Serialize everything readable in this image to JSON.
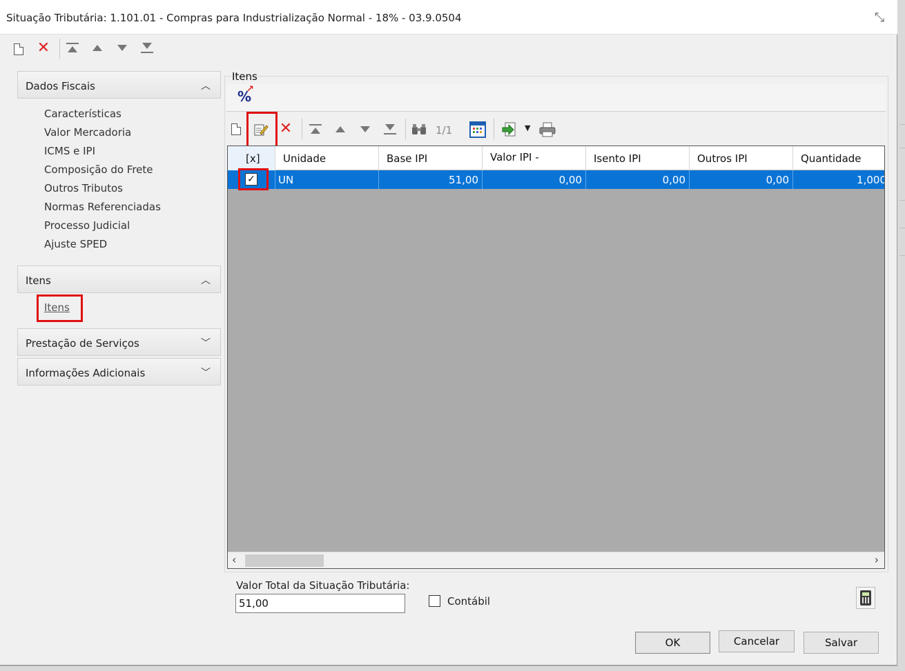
{
  "window": {
    "title": "Situação Tributária: 1.101.01 - Compras para Industrialização  Normal - 18% - 03.9.0504",
    "close_icon": "⤡"
  },
  "top_toolbar": {
    "icons": [
      "new-document-icon",
      "delete-icon",
      "move-first-icon",
      "move-up-icon",
      "move-down-icon",
      "move-last-icon"
    ]
  },
  "sidebar": {
    "groups": [
      {
        "label": "Dados Fiscais",
        "expanded": true,
        "items": [
          "Características",
          "Valor Mercadoria",
          "ICMS e IPI",
          "Composição do Frete",
          "Outros Tributos",
          "Normas Referenciadas",
          "Processo Judicial",
          "Ajuste SPED"
        ]
      },
      {
        "label": "Itens",
        "expanded": true,
        "items": [
          "Itens"
        ]
      },
      {
        "label": "Prestação de Serviços",
        "expanded": false,
        "items": []
      },
      {
        "label": "Informações Adicionais",
        "expanded": false,
        "items": []
      }
    ]
  },
  "itens_section": {
    "title": "Itens",
    "pager": "1/1"
  },
  "grid": {
    "columns": [
      "[x]",
      "Unidade",
      "Base IPI",
      "Valor IPI -",
      "Isento IPI",
      "Outros IPI",
      "Quantidade"
    ],
    "rows": [
      {
        "checked": true,
        "unidade": "UN",
        "base_ipi": "51,00",
        "valor_ipi": "0,00",
        "isento_ipi": "0,00",
        "outros_ipi": "0,00",
        "quantidade": "1,000"
      }
    ],
    "selected_row_color": "#0a74d6"
  },
  "footer": {
    "total_label": "Valor Total da Situação Tributária:",
    "total_value": "51,00",
    "contabil_label": "Contábil",
    "contabil_checked": false,
    "ok_label": "OK",
    "cancel_label": "Cancelar",
    "save_label": "Salvar"
  },
  "highlight_color": "#e01010"
}
